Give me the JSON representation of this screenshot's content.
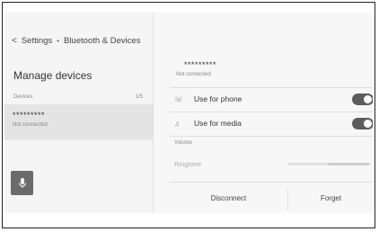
{
  "breadcrumb": {
    "parent": "Settings",
    "current": "Bluetooth & Devices"
  },
  "left": {
    "title": "Manage devices",
    "devices_label": "Devices",
    "devices_count": "1/5",
    "device": {
      "name": "*********",
      "status": "Not connected"
    }
  },
  "right": {
    "device_name": "*********",
    "device_status": "Not connected",
    "options": [
      {
        "label": "Use for phone",
        "icon": "phone-icon",
        "enabled": true
      },
      {
        "label": "Use for media",
        "icon": "music-note-icon",
        "enabled": true
      }
    ],
    "volume_label": "Volume",
    "ringtone_label": "Ringtone",
    "ringtone_level": 0.5,
    "disconnect_label": "Disconnect",
    "forget_label": "Forget"
  }
}
